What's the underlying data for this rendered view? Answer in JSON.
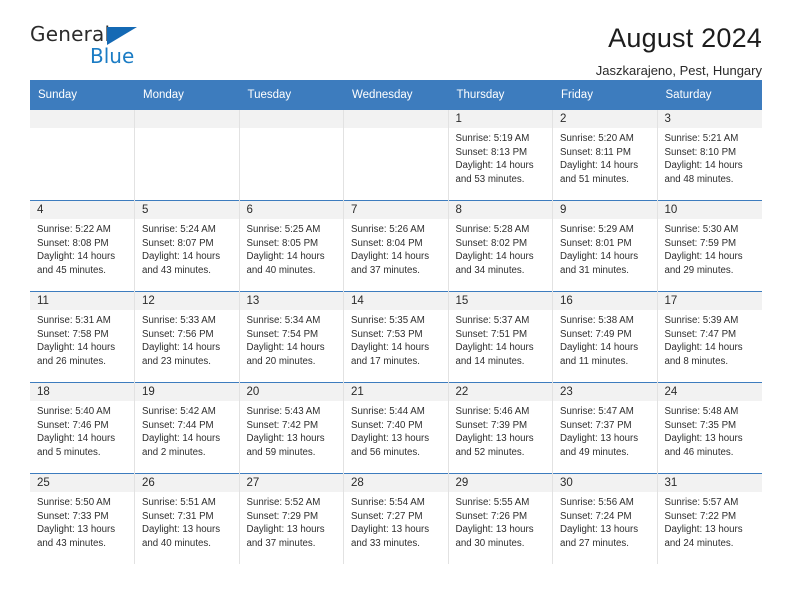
{
  "logo": {
    "text_top": "General",
    "text_bottom": "Blue",
    "triangle_icon": "blue-triangle-icon",
    "brand_blue": "#1b7cc4"
  },
  "header": {
    "title": "August 2024",
    "subtitle": "Jaszkarajeno, Pest, Hungary"
  },
  "colors": {
    "header_blue": "#3d7cbe",
    "daynum_band": "#f2f2f2",
    "cell_border": "#e2e2e2"
  },
  "weekday_headers": [
    "Sunday",
    "Monday",
    "Tuesday",
    "Wednesday",
    "Thursday",
    "Friday",
    "Saturday"
  ],
  "weeks": [
    [
      {
        "day": "",
        "lines": []
      },
      {
        "day": "",
        "lines": []
      },
      {
        "day": "",
        "lines": []
      },
      {
        "day": "",
        "lines": []
      },
      {
        "day": "1",
        "lines": [
          "Sunrise: 5:19 AM",
          "Sunset: 8:13 PM",
          "Daylight: 14 hours",
          "and 53 minutes."
        ]
      },
      {
        "day": "2",
        "lines": [
          "Sunrise: 5:20 AM",
          "Sunset: 8:11 PM",
          "Daylight: 14 hours",
          "and 51 minutes."
        ]
      },
      {
        "day": "3",
        "lines": [
          "Sunrise: 5:21 AM",
          "Sunset: 8:10 PM",
          "Daylight: 14 hours",
          "and 48 minutes."
        ]
      }
    ],
    [
      {
        "day": "4",
        "lines": [
          "Sunrise: 5:22 AM",
          "Sunset: 8:08 PM",
          "Daylight: 14 hours",
          "and 45 minutes."
        ]
      },
      {
        "day": "5",
        "lines": [
          "Sunrise: 5:24 AM",
          "Sunset: 8:07 PM",
          "Daylight: 14 hours",
          "and 43 minutes."
        ]
      },
      {
        "day": "6",
        "lines": [
          "Sunrise: 5:25 AM",
          "Sunset: 8:05 PM",
          "Daylight: 14 hours",
          "and 40 minutes."
        ]
      },
      {
        "day": "7",
        "lines": [
          "Sunrise: 5:26 AM",
          "Sunset: 8:04 PM",
          "Daylight: 14 hours",
          "and 37 minutes."
        ]
      },
      {
        "day": "8",
        "lines": [
          "Sunrise: 5:28 AM",
          "Sunset: 8:02 PM",
          "Daylight: 14 hours",
          "and 34 minutes."
        ]
      },
      {
        "day": "9",
        "lines": [
          "Sunrise: 5:29 AM",
          "Sunset: 8:01 PM",
          "Daylight: 14 hours",
          "and 31 minutes."
        ]
      },
      {
        "day": "10",
        "lines": [
          "Sunrise: 5:30 AM",
          "Sunset: 7:59 PM",
          "Daylight: 14 hours",
          "and 29 minutes."
        ]
      }
    ],
    [
      {
        "day": "11",
        "lines": [
          "Sunrise: 5:31 AM",
          "Sunset: 7:58 PM",
          "Daylight: 14 hours",
          "and 26 minutes."
        ]
      },
      {
        "day": "12",
        "lines": [
          "Sunrise: 5:33 AM",
          "Sunset: 7:56 PM",
          "Daylight: 14 hours",
          "and 23 minutes."
        ]
      },
      {
        "day": "13",
        "lines": [
          "Sunrise: 5:34 AM",
          "Sunset: 7:54 PM",
          "Daylight: 14 hours",
          "and 20 minutes."
        ]
      },
      {
        "day": "14",
        "lines": [
          "Sunrise: 5:35 AM",
          "Sunset: 7:53 PM",
          "Daylight: 14 hours",
          "and 17 minutes."
        ]
      },
      {
        "day": "15",
        "lines": [
          "Sunrise: 5:37 AM",
          "Sunset: 7:51 PM",
          "Daylight: 14 hours",
          "and 14 minutes."
        ]
      },
      {
        "day": "16",
        "lines": [
          "Sunrise: 5:38 AM",
          "Sunset: 7:49 PM",
          "Daylight: 14 hours",
          "and 11 minutes."
        ]
      },
      {
        "day": "17",
        "lines": [
          "Sunrise: 5:39 AM",
          "Sunset: 7:47 PM",
          "Daylight: 14 hours",
          "and 8 minutes."
        ]
      }
    ],
    [
      {
        "day": "18",
        "lines": [
          "Sunrise: 5:40 AM",
          "Sunset: 7:46 PM",
          "Daylight: 14 hours",
          "and 5 minutes."
        ]
      },
      {
        "day": "19",
        "lines": [
          "Sunrise: 5:42 AM",
          "Sunset: 7:44 PM",
          "Daylight: 14 hours",
          "and 2 minutes."
        ]
      },
      {
        "day": "20",
        "lines": [
          "Sunrise: 5:43 AM",
          "Sunset: 7:42 PM",
          "Daylight: 13 hours",
          "and 59 minutes."
        ]
      },
      {
        "day": "21",
        "lines": [
          "Sunrise: 5:44 AM",
          "Sunset: 7:40 PM",
          "Daylight: 13 hours",
          "and 56 minutes."
        ]
      },
      {
        "day": "22",
        "lines": [
          "Sunrise: 5:46 AM",
          "Sunset: 7:39 PM",
          "Daylight: 13 hours",
          "and 52 minutes."
        ]
      },
      {
        "day": "23",
        "lines": [
          "Sunrise: 5:47 AM",
          "Sunset: 7:37 PM",
          "Daylight: 13 hours",
          "and 49 minutes."
        ]
      },
      {
        "day": "24",
        "lines": [
          "Sunrise: 5:48 AM",
          "Sunset: 7:35 PM",
          "Daylight: 13 hours",
          "and 46 minutes."
        ]
      }
    ],
    [
      {
        "day": "25",
        "lines": [
          "Sunrise: 5:50 AM",
          "Sunset: 7:33 PM",
          "Daylight: 13 hours",
          "and 43 minutes."
        ]
      },
      {
        "day": "26",
        "lines": [
          "Sunrise: 5:51 AM",
          "Sunset: 7:31 PM",
          "Daylight: 13 hours",
          "and 40 minutes."
        ]
      },
      {
        "day": "27",
        "lines": [
          "Sunrise: 5:52 AM",
          "Sunset: 7:29 PM",
          "Daylight: 13 hours",
          "and 37 minutes."
        ]
      },
      {
        "day": "28",
        "lines": [
          "Sunrise: 5:54 AM",
          "Sunset: 7:27 PM",
          "Daylight: 13 hours",
          "and 33 minutes."
        ]
      },
      {
        "day": "29",
        "lines": [
          "Sunrise: 5:55 AM",
          "Sunset: 7:26 PM",
          "Daylight: 13 hours",
          "and 30 minutes."
        ]
      },
      {
        "day": "30",
        "lines": [
          "Sunrise: 5:56 AM",
          "Sunset: 7:24 PM",
          "Daylight: 13 hours",
          "and 27 minutes."
        ]
      },
      {
        "day": "31",
        "lines": [
          "Sunrise: 5:57 AM",
          "Sunset: 7:22 PM",
          "Daylight: 13 hours",
          "and 24 minutes."
        ]
      }
    ]
  ]
}
